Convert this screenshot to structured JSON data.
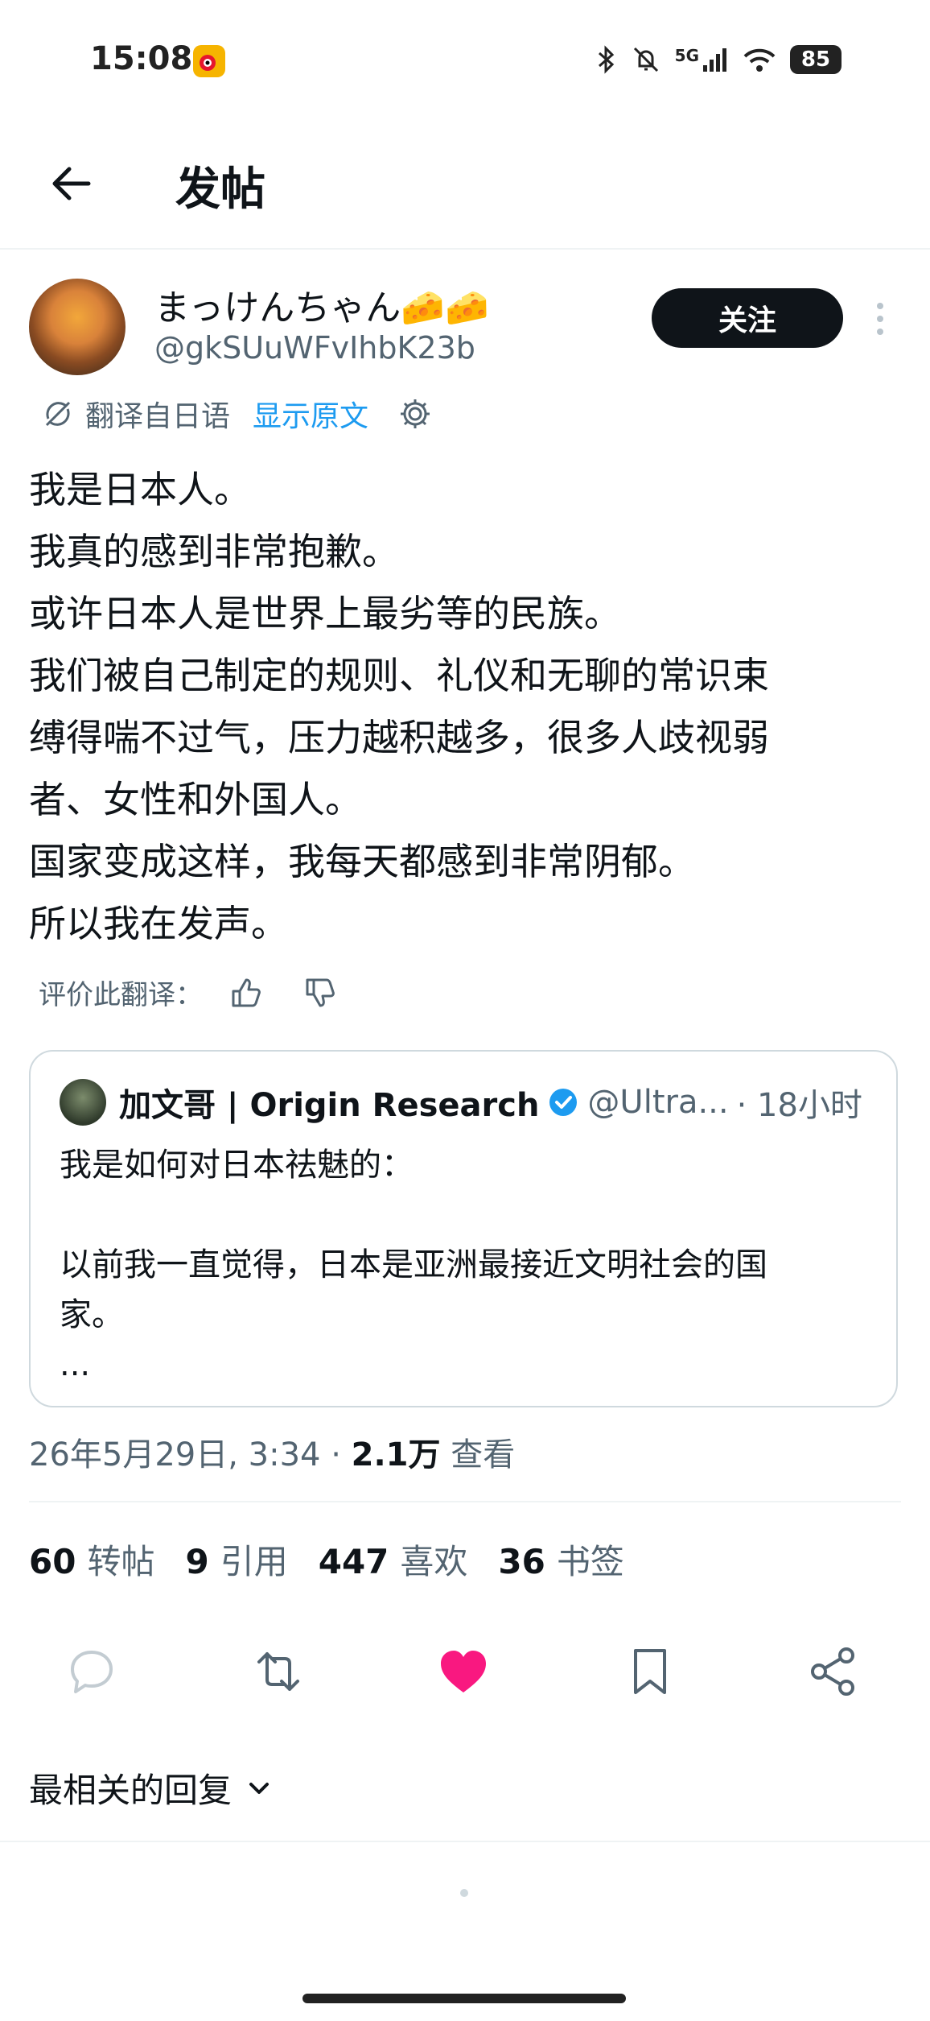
{
  "status_bar": {
    "time": "15:08",
    "network": "5G",
    "battery": "85",
    "icons": [
      "weibo-icon",
      "bluetooth-icon",
      "mute-icon",
      "signal-icon",
      "wifi-icon",
      "battery-icon"
    ]
  },
  "header": {
    "title": "发帖",
    "back_icon": "arrow-left-icon"
  },
  "author": {
    "name": "まっけんちゃん🧀🧀",
    "handle": "@gkSUuWFvIhbK23b",
    "follow_label": "关注"
  },
  "translation": {
    "label": "翻译自日语",
    "show_original": "显示原文"
  },
  "tweet": {
    "lines": [
      "我是日本人。",
      "我真的感到非常抱歉。",
      "或许日本人是世界上最劣等的民族。",
      "我们被自己制定的规则、礼仪和无聊的常识束",
      "缚得喘不过气，压力越积越多，很多人歧视弱",
      "者、女性和外国人。",
      "国家变成这样，我每天都感到非常阴郁。",
      "所以我在发声。"
    ],
    "rate_label": "评价此翻译："
  },
  "quote": {
    "name": "加文哥 | Origin Research",
    "handle": "@Ultra...",
    "time": "· 18小时",
    "lines": [
      "我是如何对日本祛魅的：",
      "",
      "以前我一直觉得，日本是亚洲最接近文明社会的国",
      "家。",
      "..."
    ]
  },
  "meta": {
    "date": "26年5月29日, 3:34 ·",
    "views_count": "2.1万",
    "views_label": "查看"
  },
  "stats": {
    "reposts_count": "60",
    "reposts_label": "转帖",
    "quotes_count": "9",
    "quotes_label": "引用",
    "likes_count": "447",
    "likes_label": "喜欢",
    "bookmarks_count": "36",
    "bookmarks_label": "书签"
  },
  "colors": {
    "like_active": "#f91880",
    "link": "#1d9bf0",
    "verified": "#1d9bf0",
    "secondary_text": "#536471"
  },
  "replies": {
    "sort_label": "最相关的回复"
  }
}
